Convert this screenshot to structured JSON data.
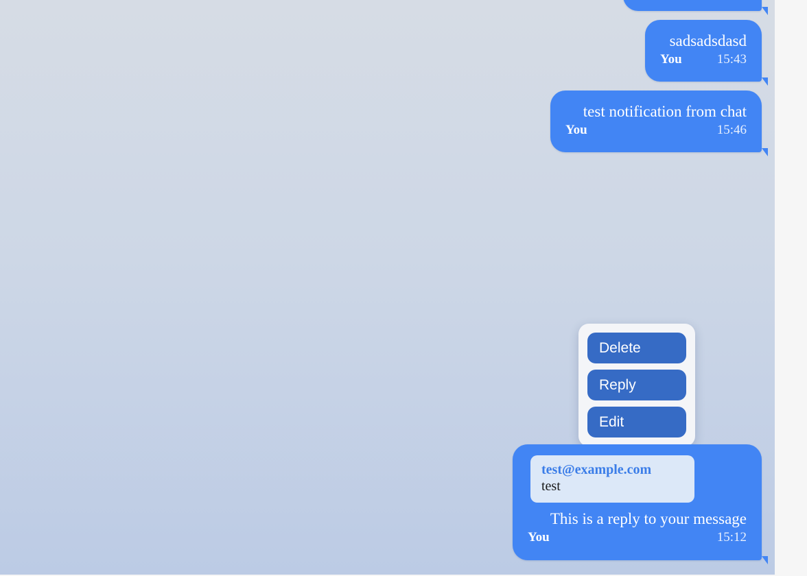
{
  "messages": [
    {
      "text": "",
      "sender": "",
      "time": ""
    },
    {
      "text": "sadsadsdasd",
      "sender": "You",
      "time": "15:43"
    },
    {
      "text": "test notification from chat",
      "sender": "You",
      "time": "15:46"
    },
    {
      "reply_to": {
        "author": "test@example.com",
        "text": "test"
      },
      "text": "This is a reply to your message",
      "sender": "You",
      "time": "15:12"
    }
  ],
  "context_menu": {
    "items": [
      {
        "label": "Delete"
      },
      {
        "label": "Reply"
      },
      {
        "label": "Edit"
      }
    ]
  },
  "colors": {
    "bubble": "#4285f4",
    "menu_button": "#366bc5",
    "quote_background": "#dce8f8",
    "quote_author": "#3b7de8"
  }
}
